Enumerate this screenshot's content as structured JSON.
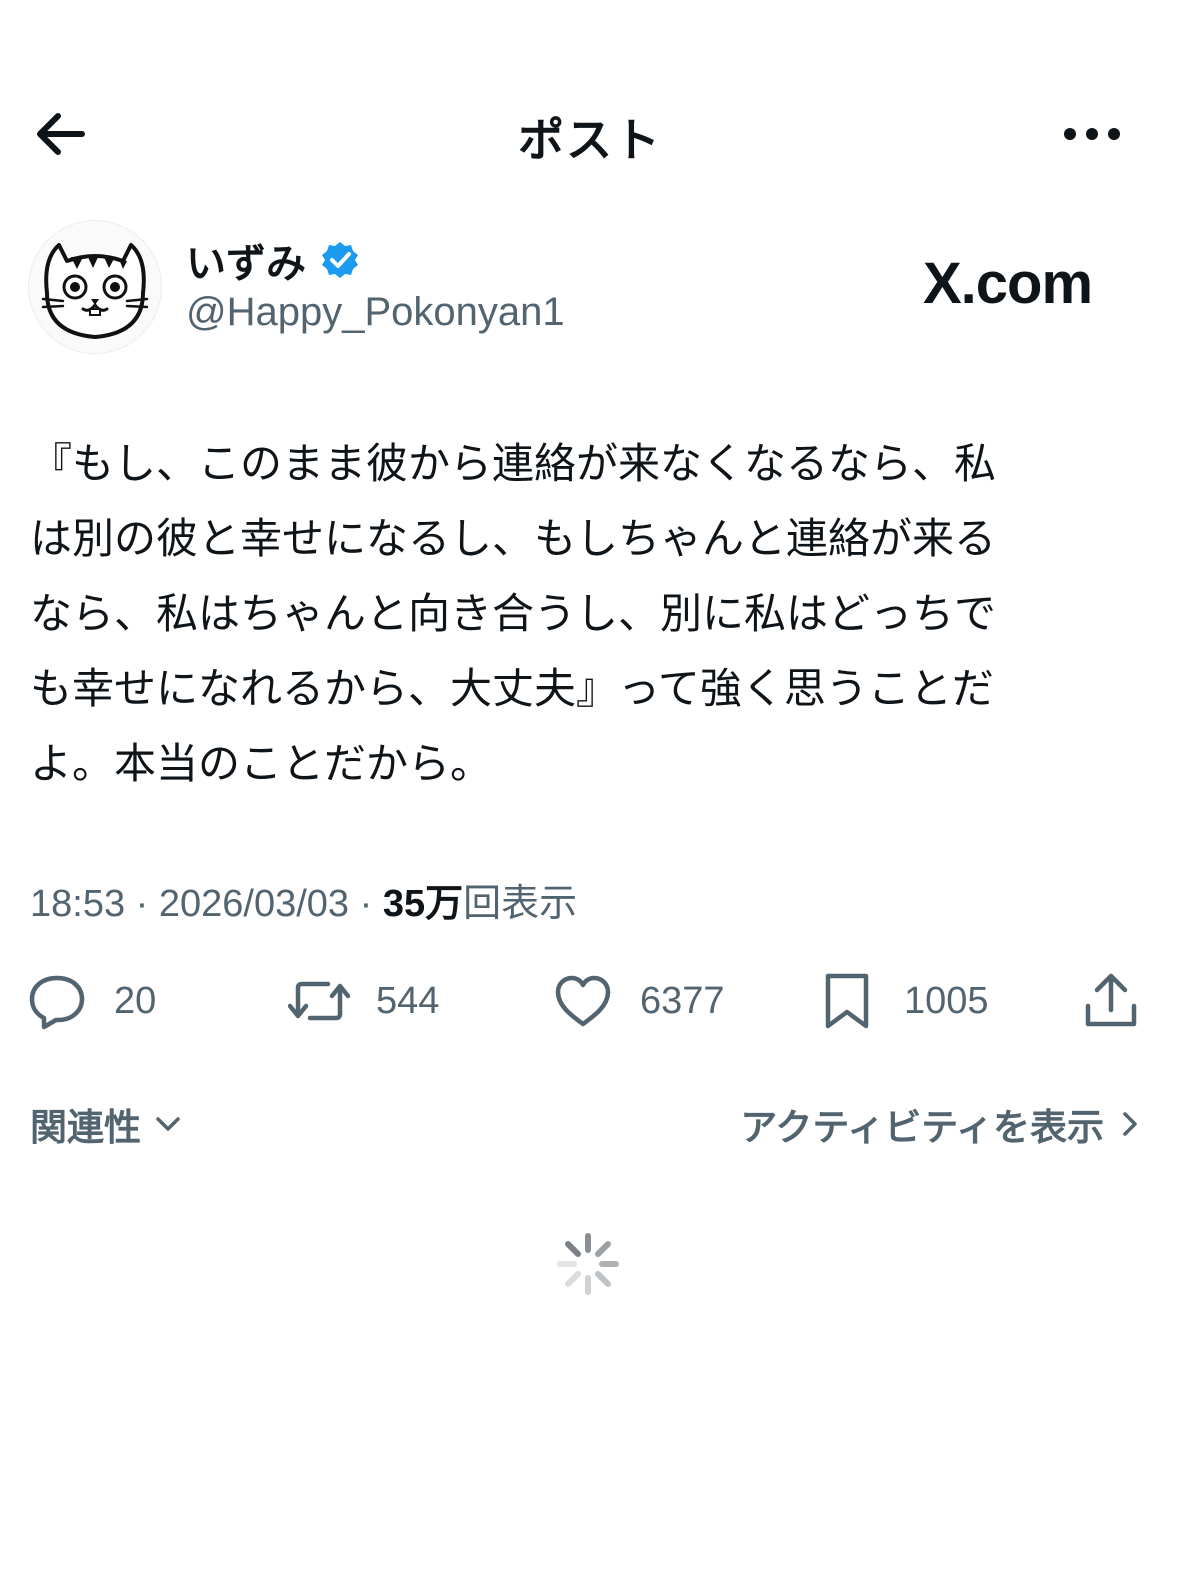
{
  "header": {
    "title": "ポスト"
  },
  "author": {
    "display_name": "いずみ",
    "handle": "@Happy_Pokonyan1",
    "verified": true
  },
  "watermark": "X.com",
  "post": {
    "text": "『もし、このまま彼から連絡が来なくなるなら、私\nは別の彼と幸せになるし、もしちゃんと連絡が来る\nなら、私はちゃんと向き合うし、別に私はどっちで\nも幸せになれるから、大丈夫』って強く思うことだ\nよ。本当のことだから。",
    "time": "18:53",
    "date": "2026/03/03",
    "separator": "·",
    "views_count": "35万",
    "views_label": "回表示"
  },
  "actions": {
    "replies": "20",
    "reposts": "544",
    "likes": "6377",
    "bookmarks": "1005"
  },
  "filters": {
    "relevance_label": "関連性",
    "activity_label": "アクティビティを表示"
  },
  "colors": {
    "text": "#0f1419",
    "secondary": "#536471",
    "verified": "#1d9bf0"
  }
}
